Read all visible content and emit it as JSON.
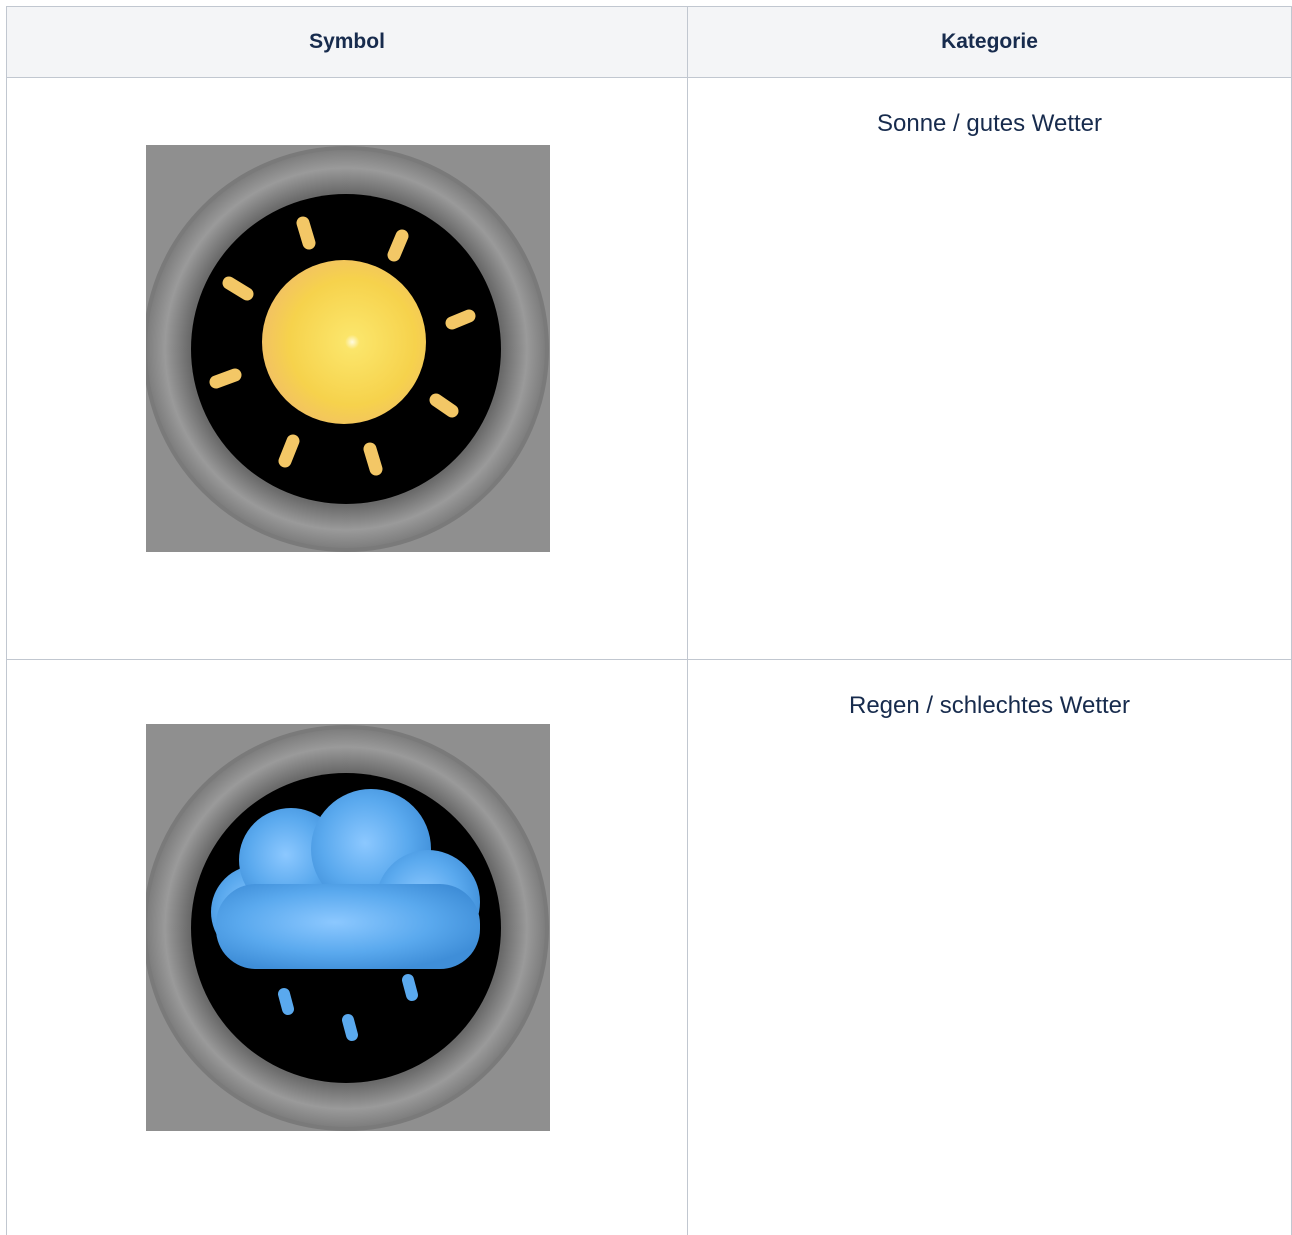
{
  "table": {
    "headers": {
      "symbol": "Symbol",
      "category": "Kategorie"
    },
    "rows": [
      {
        "icon": "sun-icon",
        "category": "Sonne / gutes Wetter"
      },
      {
        "icon": "rain-cloud-icon",
        "category": "Regen / schlechtes Wetter"
      }
    ]
  },
  "colors": {
    "header_bg": "#f4f5f7",
    "border": "#c1c7d0",
    "text": "#172b4d",
    "icon_bg": "#8f8f8f",
    "sun": "#f7d64a",
    "ray": "#f3c766",
    "cloud": "#5aa9ee"
  }
}
